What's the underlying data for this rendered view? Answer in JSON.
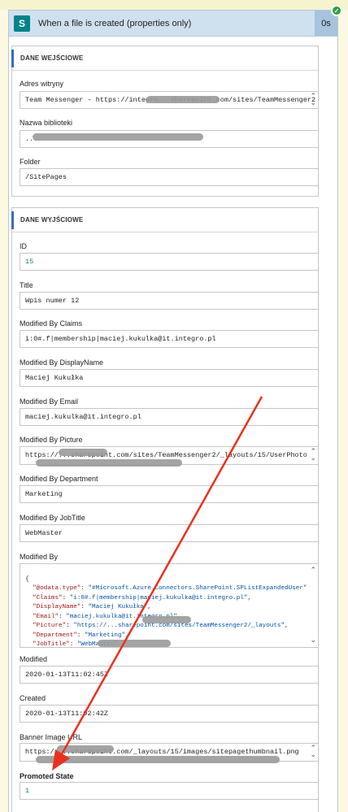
{
  "header": {
    "title": "When a file is created (properties only)",
    "duration": "0s",
    "icon_label": "S"
  },
  "inputs": {
    "section_title": "DANE WEJŚCIOWE",
    "site_label": "Adres witryny",
    "site_value": "Team Messenger - https://integro...sharepoint.com/sites/TeamMessenger2",
    "library_label": "Nazwa biblioteki",
    "library_value": "...",
    "folder_label": "Folder",
    "folder_value": "/SitePages"
  },
  "outputs": {
    "section_title": "DANE WYJŚCIOWE",
    "id_label": "ID",
    "id_value": "15",
    "title_label": "Title",
    "title_value": "Wpis numer 12",
    "mbc_label": "Modified By Claims",
    "mbc_value": "i:0#.f|membership|maciej.kukulka@it.integro.pl",
    "mbd_label": "Modified By DisplayName",
    "mbd_value": "Maciej Kukułka",
    "mbe_label": "Modified By Email",
    "mbe_value": "maciej.kukulka@it.integro.pl",
    "mbp_label": "Modified By Picture",
    "mbp_value": "https://...sharepoint.com/sites/TeamMessenger2/_layouts/15/UserPhoto",
    "mbdep_label": "Modified By Department",
    "mbdep_value": "Marketing",
    "mbj_label": "Modified By JobTitle",
    "mbj_value": "WebMaster",
    "mb_label": "Modified By",
    "mb_json": [
      {
        "text": "{"
      },
      {
        "key": "\"@odata.type\"",
        "val": "\"#Microsoft.Azure.Connectors.SharePoint.SPListExpandedUser\""
      },
      {
        "key": "\"Claims\"",
        "val": "\"i:0#.f|membership|maciej.kukulka@it.integro.pl\","
      },
      {
        "key": "\"DisplayName\"",
        "val": "\"Maciej Kukułka\","
      },
      {
        "key": "\"Email\"",
        "val": "\"maciej.kukulka@it.integro.pl\","
      },
      {
        "key": "\"Picture\"",
        "val": "\"https://...sharepoint.com/sites/TeamMessenger2/_layouts\","
      },
      {
        "key": "\"Department\"",
        "val": "\"Marketing\","
      },
      {
        "key": "\"JobTitle\"",
        "val": "\"WebMaster\""
      }
    ],
    "modified_label": "Modified",
    "modified_value": "2020-01-13T11:02:45Z",
    "created_label": "Created",
    "created_value": "2020-01-13T11:02:42Z",
    "banner_label": "Banner Image URL",
    "banner_value": "https://...sharepoint.com/_layouts/15/images/sitepagethumbnail.png",
    "promoted_label": "Promoted State",
    "promoted_value": "1"
  },
  "colors": {
    "accent": "#3a6bb6",
    "arrow": "#e8321f",
    "success": "#2e9e3e"
  }
}
